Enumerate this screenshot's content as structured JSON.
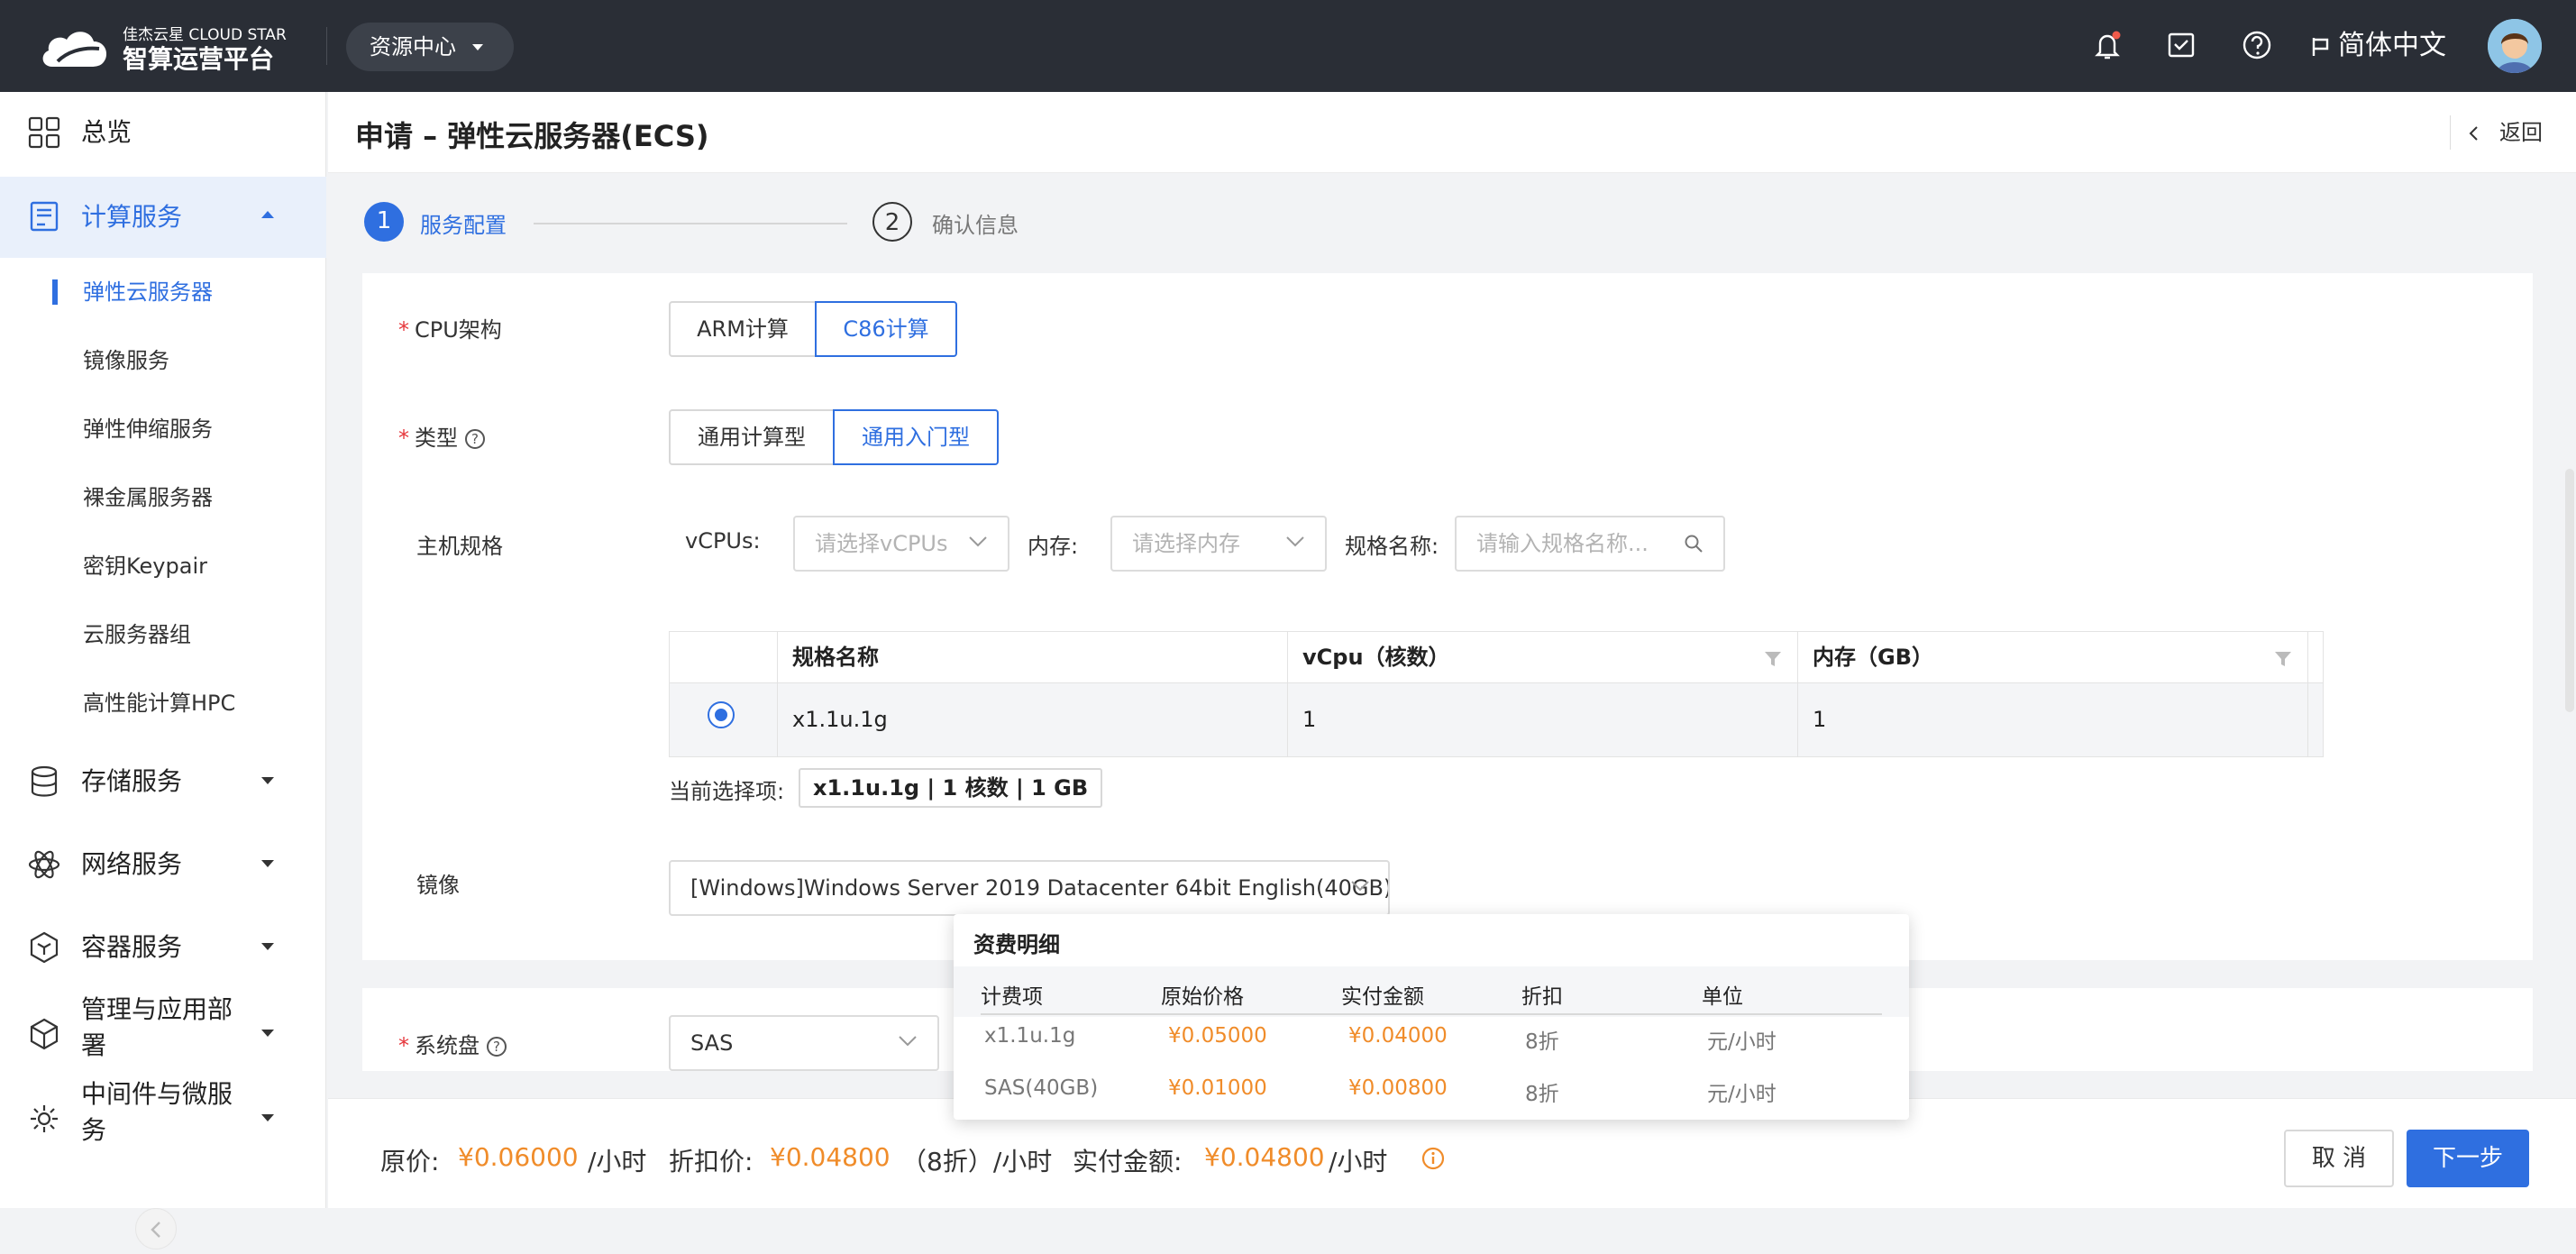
{
  "topbar": {
    "logo_sub": "佳杰云星 CLOUD STAR",
    "logo_main": "智算运营平台",
    "resource_select": "资源中心",
    "language": "简体中文"
  },
  "sidebar": {
    "overview": "总览",
    "compute": "计算服务",
    "compute_items": [
      "弹性云服务器",
      "镜像服务",
      "弹性伸缩服务",
      "裸金属服务器",
      "密钥Keypair",
      "云服务器组",
      "高性能计算HPC"
    ],
    "storage": "存储服务",
    "network": "网络服务",
    "container": "容器服务",
    "management": "管理与应用部署",
    "middleware": "中间件与微服务"
  },
  "page": {
    "title": "申请 – 弹性云服务器(ECS)",
    "back": "返回"
  },
  "steps": [
    {
      "num": "1",
      "label": "服务配置"
    },
    {
      "num": "2",
      "label": "确认信息"
    }
  ],
  "form": {
    "cpu_label": "CPU架构",
    "cpu_options": [
      "ARM计算",
      "C86计算"
    ],
    "cpu_selected": "C86计算",
    "type_label": "类型",
    "type_options": [
      "通用计算型",
      "通用入门型"
    ],
    "type_selected": "通用入门型",
    "spec_label": "主机规格",
    "vcpu_label": "vCPUs:",
    "vcpu_placeholder": "请选择vCPUs",
    "mem_label": "内存:",
    "mem_placeholder": "请选择内存",
    "name_label": "规格名称:",
    "name_placeholder": "请输入规格名称...",
    "table": {
      "headers": [
        "规格名称",
        "vCpu（核数）",
        "内存（GB）"
      ],
      "rows": [
        [
          "x1.1u.1g",
          "1",
          "1"
        ]
      ]
    },
    "current_label": "当前选择项:",
    "current_value": "x1.1u.1g | 1 核数 | 1 GB",
    "image_label": "镜像",
    "image_value": "[Windows]Windows Server 2019 Datacenter 64bit English(40GB)",
    "disk_label": "系统盘",
    "disk_value": "SAS"
  },
  "fee_popover": {
    "title": "资费明细",
    "headers": [
      "计费项",
      "原始价格",
      "实付金额",
      "折扣",
      "单位"
    ],
    "rows": [
      [
        "x1.1u.1g",
        "¥0.05000",
        "¥0.04000",
        "8折",
        "元/小时"
      ],
      [
        "SAS(40GB)",
        "¥0.01000",
        "¥0.00800",
        "8折",
        "元/小时"
      ]
    ]
  },
  "bottom": {
    "orig_label": "原价:",
    "orig_value": "¥0.06000",
    "per_hour": "/小时",
    "disc_label": "折扣价:",
    "disc_value": "¥0.04800",
    "disc_rate": "（8折）/小时",
    "paid_label": "实付金额:",
    "paid_value": "¥0.04800",
    "cancel": "取 消",
    "next": "下一步"
  },
  "colors": {
    "primary": "#2f6fe0",
    "price": "#f08c2a",
    "topbar": "#2a2e36",
    "required": "#e6363b"
  }
}
